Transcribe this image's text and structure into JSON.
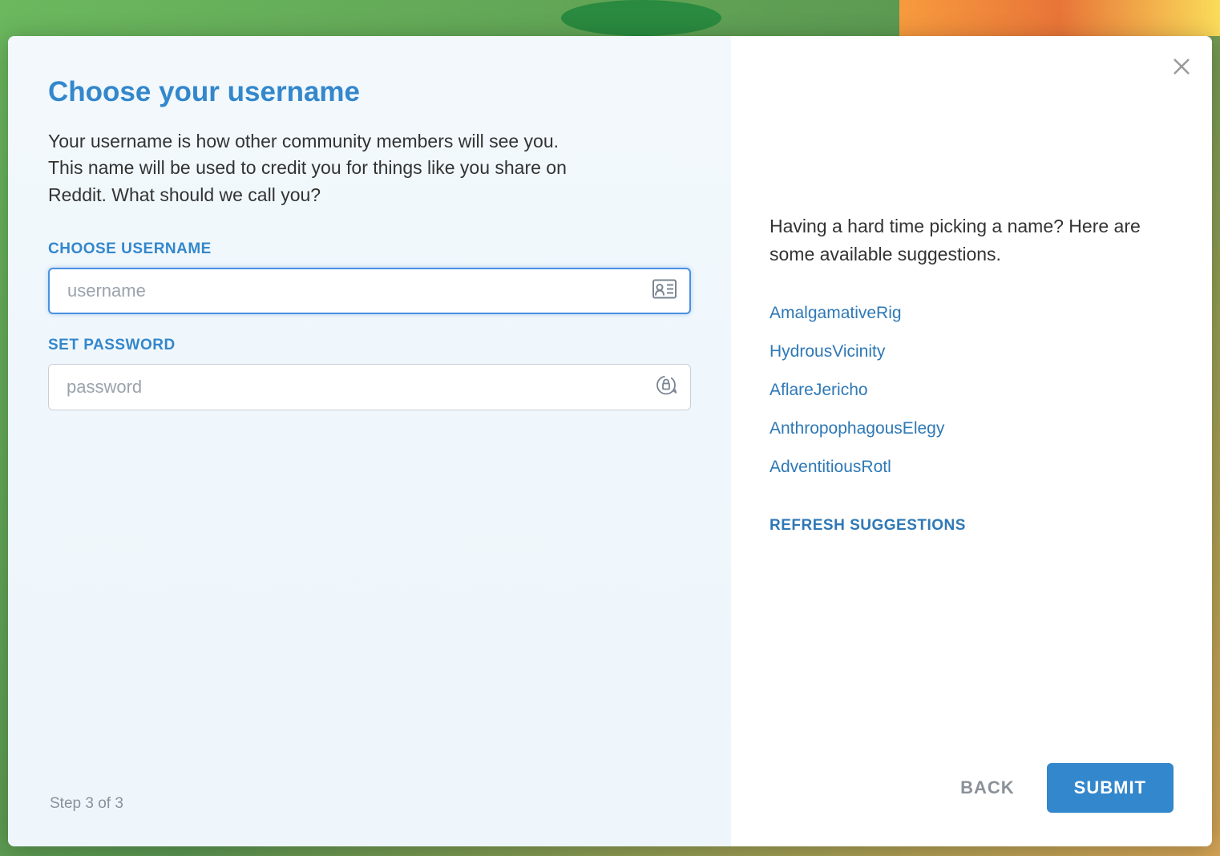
{
  "left": {
    "title": "Choose your username",
    "description": "Your username is how other community members will see you. This name will be used to credit you for things like you share on Reddit. What should we call you?",
    "username_label": "CHOOSE USERNAME",
    "username_placeholder": "username",
    "password_label": "SET PASSWORD",
    "password_placeholder": "password",
    "step_text": "Step 3 of 3"
  },
  "right": {
    "suggestions_intro": "Having a hard time picking a name? Here are some available suggestions.",
    "suggestions": [
      "AmalgamativeRig",
      "HydrousVicinity",
      "AflareJericho",
      "AnthropophagousElegy",
      "AdventitiousRotl"
    ],
    "refresh_label": "REFRESH SUGGESTIONS",
    "back_label": "BACK",
    "submit_label": "SUBMIT"
  }
}
